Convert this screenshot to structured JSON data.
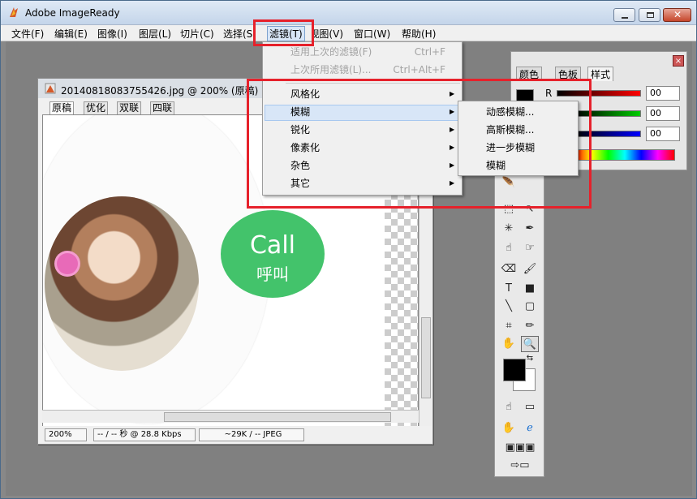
{
  "app": {
    "title": "Adobe ImageReady"
  },
  "menubar": [
    {
      "label": "文件(F)"
    },
    {
      "label": "编辑(E)"
    },
    {
      "label": "图像(I)"
    },
    {
      "label": "图层(L)"
    },
    {
      "label": "切片(C)"
    },
    {
      "label": "选择(S)"
    },
    {
      "label": "滤镜(T)"
    },
    {
      "label": "视图(V)"
    },
    {
      "label": "窗口(W)"
    },
    {
      "label": "帮助(H)"
    }
  ],
  "filter_menu": {
    "items": [
      {
        "label": "适用上次的滤镜(F)",
        "shortcut": "Ctrl+F"
      },
      {
        "label": "上次所用滤镜(L)...",
        "shortcut": "Ctrl+Alt+F"
      },
      {
        "label": "风格化"
      },
      {
        "label": "模糊"
      },
      {
        "label": "锐化"
      },
      {
        "label": "像素化"
      },
      {
        "label": "杂色"
      },
      {
        "label": "其它"
      }
    ]
  },
  "blur_submenu": {
    "items": [
      {
        "label": "动感模糊..."
      },
      {
        "label": "高斯模糊..."
      },
      {
        "label": "进一步模糊"
      },
      {
        "label": "模糊"
      }
    ]
  },
  "document": {
    "title": "20140818083755426.jpg @ 200% (原稿)",
    "tabs": [
      {
        "label": "原稿"
      },
      {
        "label": "优化"
      },
      {
        "label": "双联"
      },
      {
        "label": "四联"
      }
    ],
    "canvas": {
      "call_text": "Call",
      "call_sub": "呼叫"
    },
    "status": {
      "zoom": "200%",
      "speed": "-- / -- 秒 @ 28.8 Kbps",
      "size": "~29K / -- JPEG"
    }
  },
  "color_panel": {
    "tabs": [
      {
        "label": "颜色"
      },
      {
        "label": "色板"
      },
      {
        "label": "样式"
      }
    ],
    "channel_label": "R",
    "values": [
      "00",
      "00",
      "00"
    ]
  },
  "colors": {
    "highlight": "#e6212b",
    "call_green": "#43c36b"
  },
  "icons": [
    "adobe-imageready-logo-icon",
    "minimize-icon",
    "maximize-icon",
    "close-icon"
  ]
}
